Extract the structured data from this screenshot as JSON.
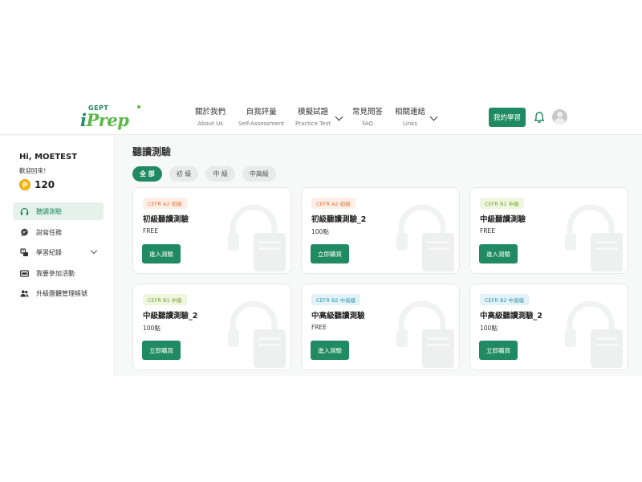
{
  "header": {
    "logo_small": "GEPT",
    "logo_i": "i",
    "logo_word": "Prep",
    "nav": [
      {
        "zh": "關於我們",
        "en": "About Us"
      },
      {
        "zh": "自我評量",
        "en": "Self-Assessment"
      },
      {
        "zh": "模擬試題",
        "en": "Practice Test"
      },
      {
        "zh": "常見問答",
        "en": "FAQ"
      },
      {
        "zh": "相關連結",
        "en": "Links"
      }
    ],
    "my_learning": "我的學習",
    "icons": {
      "bell": "bell-icon",
      "avatar": "avatar-icon"
    }
  },
  "sidebar": {
    "greeting": "Hi, MOETEST",
    "welcome": "歡迎回來！",
    "points_symbol": "P",
    "points": "120",
    "items": [
      {
        "label": "聽讀測驗",
        "icon": "headphones-icon"
      },
      {
        "label": "說寫任務",
        "icon": "chat-icon"
      },
      {
        "label": "學習紀錄",
        "icon": "record-icon"
      },
      {
        "label": "我要參加活動",
        "icon": "ticket-icon"
      },
      {
        "label": "升級團體管理帳號",
        "icon": "group-icon"
      }
    ]
  },
  "main": {
    "title": "聽讀測驗",
    "filters": [
      "全 部",
      "初 級",
      "中 級",
      "中高級"
    ],
    "cards": [
      {
        "tag": "CEFR A2 初級",
        "title": "初級聽讀測驗",
        "price": "FREE",
        "button": "進入測驗"
      },
      {
        "tag": "CEFR A2 初級",
        "title": "初級聽讀測驗_2",
        "price": "100點",
        "button": "立即購買"
      },
      {
        "tag": "CEFR B1 中級",
        "title": "中級聽讀測驗",
        "price": "FREE",
        "button": "進入測驗"
      },
      {
        "tag": "CEFR B1 中級",
        "title": "中級聽讀測驗_2",
        "price": "100點",
        "button": "立即購買"
      },
      {
        "tag": "CEFR B2 中高級",
        "title": "中高級聽讀測驗",
        "price": "FREE",
        "button": "進入測驗"
      },
      {
        "tag": "CEFR B2 中高級",
        "title": "中高級聽讀測驗_2",
        "price": "100點",
        "button": "立即購買"
      }
    ]
  },
  "colors": {
    "brand": "#1f8a63",
    "accent_green": "#5ab847",
    "tag_a2": "#e57431",
    "tag_b1": "#74a42a",
    "tag_b2": "#2b93b0",
    "coin": "#f5b91c"
  }
}
